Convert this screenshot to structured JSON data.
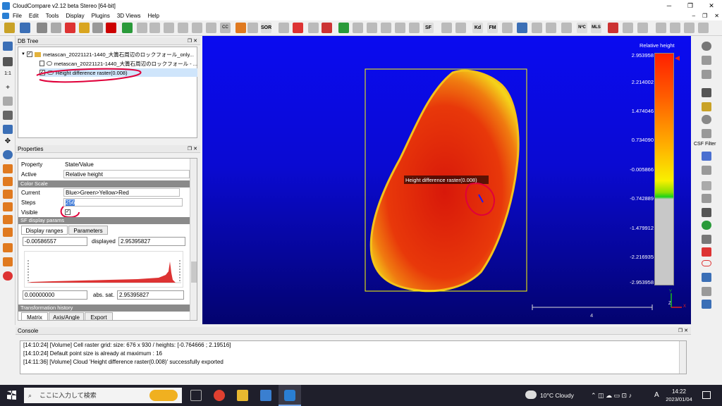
{
  "window": {
    "title": "CloudCompare v2.12 beta Stereo [64-bit]",
    "controls": [
      "─",
      "❐",
      "✕"
    ]
  },
  "menu": [
    "File",
    "Edit",
    "Tools",
    "Display",
    "Plugins",
    "3D Views",
    "Help"
  ],
  "mdi_controls": [
    "–",
    "❐",
    "✕"
  ],
  "toolbar_labels": {
    "sor": "SOR",
    "sf": "SF",
    "kd": "Kd",
    "fm": "FM",
    "nc": "N²C",
    "mls": "MLS",
    "cc": "CC"
  },
  "right_toolbar": {
    "csf_label": "CSF Filter"
  },
  "db_tree": {
    "title": "DB Tree",
    "items": [
      "metascan_20221121-1440_大簀石周辺のロックフォール_only...",
      "metascan_20221121-1440_大簀石周辺のロックフォール - ...",
      "Height difference raster(0.008)"
    ]
  },
  "properties": {
    "title": "Properties",
    "header": {
      "property": "Property",
      "value": "State/Value"
    },
    "active": {
      "key": "Active",
      "value": "Relative height"
    },
    "color_scale_section": "Color Scale",
    "current": {
      "key": "Current",
      "value": "Blue>Green>Yellow>Red"
    },
    "steps": {
      "key": "Steps",
      "value": "256"
    },
    "visible": {
      "key": "Visible",
      "checked": "✓"
    },
    "sf_section": "SF display params",
    "tabs": [
      "Display ranges",
      "Parameters"
    ],
    "range_min": "-0.00586557",
    "displayed_label": "displayed",
    "range_max": "2.95395827",
    "sat_min": "0.00000000",
    "abs_sat_label": "abs. sat.",
    "sat_max": "2.95395827",
    "transform_section": "Transformation history",
    "transform_tabs": [
      "Matrix",
      "Axis/Angle",
      "Export"
    ]
  },
  "viewport": {
    "label": "Height difference raster(0.008)",
    "scale_title": "Relative height",
    "scale_ticks": [
      "2.953958",
      "2.214002",
      "1.474046",
      "0.734090",
      "-0.005866",
      "-0.742889",
      "-1.479912",
      "-2.216935",
      "-2.953958"
    ],
    "scale_length": "4",
    "axes": {
      "y": "Y",
      "z": "Z",
      "x": "X"
    }
  },
  "console": {
    "title": "Console",
    "lines": [
      "[14:10:24] [Volume] Cell raster grid: size: 676 x 930 / heights: [-0.764666 ; 2.19516]",
      "[14:10:24] Default point size is already at maximum : 16",
      "[14:11:36] [Volume] Cloud 'Height difference raster(0.008)' successfully exported"
    ]
  },
  "taskbar": {
    "search_placeholder": "ここに入力して検索",
    "weather": "10°C Cloudy",
    "ime": "A",
    "time": "14:22",
    "date": "2023/01/04"
  },
  "colors": {
    "viewport_top": "#0a0bf0",
    "scale_red": "#ff2000",
    "annotation_red": "#e0003a"
  }
}
